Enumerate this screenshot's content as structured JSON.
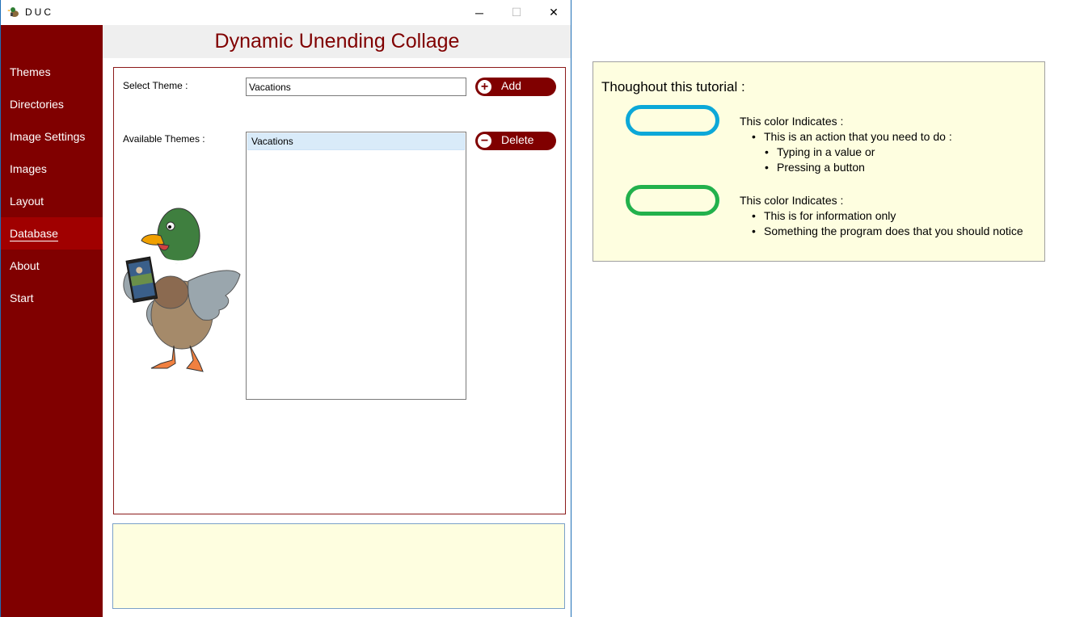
{
  "window": {
    "title": "DUC",
    "minimize_glyph": "─",
    "maximize_glyph": "☐",
    "close_glyph": "✕"
  },
  "sidebar": {
    "items": [
      {
        "label": "Themes"
      },
      {
        "label": "Directories"
      },
      {
        "label": "Image Settings"
      },
      {
        "label": "Images"
      },
      {
        "label": "Layout"
      },
      {
        "label": "Database",
        "active": true
      },
      {
        "label": "About"
      },
      {
        "label": "Start"
      }
    ]
  },
  "header": {
    "title": "Dynamic Unending Collage"
  },
  "form": {
    "select_theme_label": "Select Theme :",
    "select_theme_value": "Vacations",
    "available_themes_label": "Available Themes :",
    "available_themes": [
      "Vacations"
    ],
    "add_label": "Add",
    "delete_label": "Delete",
    "add_symbol": "+",
    "delete_symbol": "−"
  },
  "tutorial": {
    "heading": "Thoughout this tutorial :",
    "action": {
      "color": "#0ca8d8",
      "indicates": "This color Indicates :",
      "line1": "This is an action that you need to do :",
      "line2": "Typing in a value or",
      "line3": "Pressing a button"
    },
    "info": {
      "color": "#22b14c",
      "indicates": "This color Indicates :",
      "line1": "This is for information only",
      "line2": "Something the program does that you should notice"
    }
  },
  "colors": {
    "brand": "#800000",
    "active_nav": "#a00000",
    "note_background": "#fefee0"
  },
  "icons": {
    "app": "duck-logo-icon",
    "add": "plus-circle-icon",
    "delete": "minus-circle-icon"
  }
}
